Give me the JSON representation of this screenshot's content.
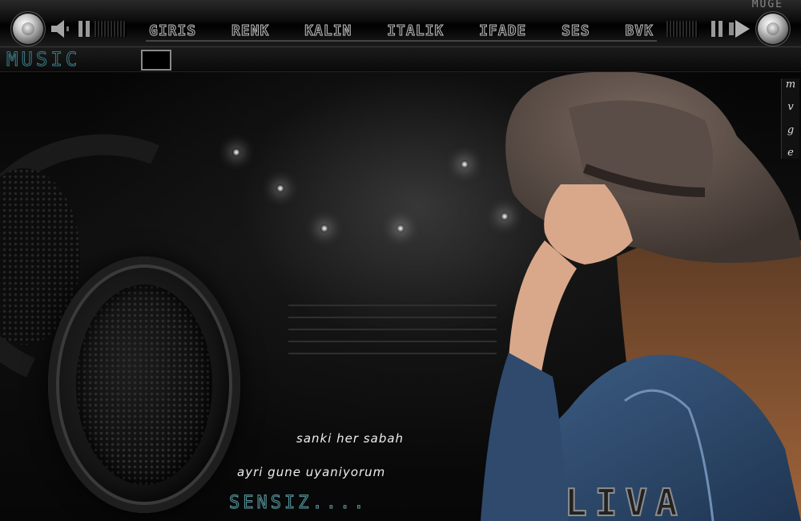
{
  "brand": "MUGE",
  "nav": {
    "items": [
      "GIRIS",
      "RENK",
      "KALIN",
      "ITALIK",
      "IFADE",
      "SES",
      "BVK"
    ]
  },
  "subbar": {
    "title": "MUSIC"
  },
  "side_letters": [
    "m",
    "v",
    "g",
    "e"
  ],
  "lyrics": {
    "line1": "sanki her sabah",
    "line2": "ayri gune uyaniyorum",
    "line3": "SENSIZ...."
  },
  "signature": "LIVA",
  "icons": {
    "left_knob": "volume-knob-icon",
    "left_speaker": "speaker-icon",
    "left_pause": "pause-icon",
    "right_pause": "pause-icon",
    "right_play": "play-icon",
    "right_knob": "volume-knob-icon"
  },
  "colors": {
    "accent": "#3f7b86",
    "chrome": "#bdbdbd",
    "background": "#000000"
  }
}
